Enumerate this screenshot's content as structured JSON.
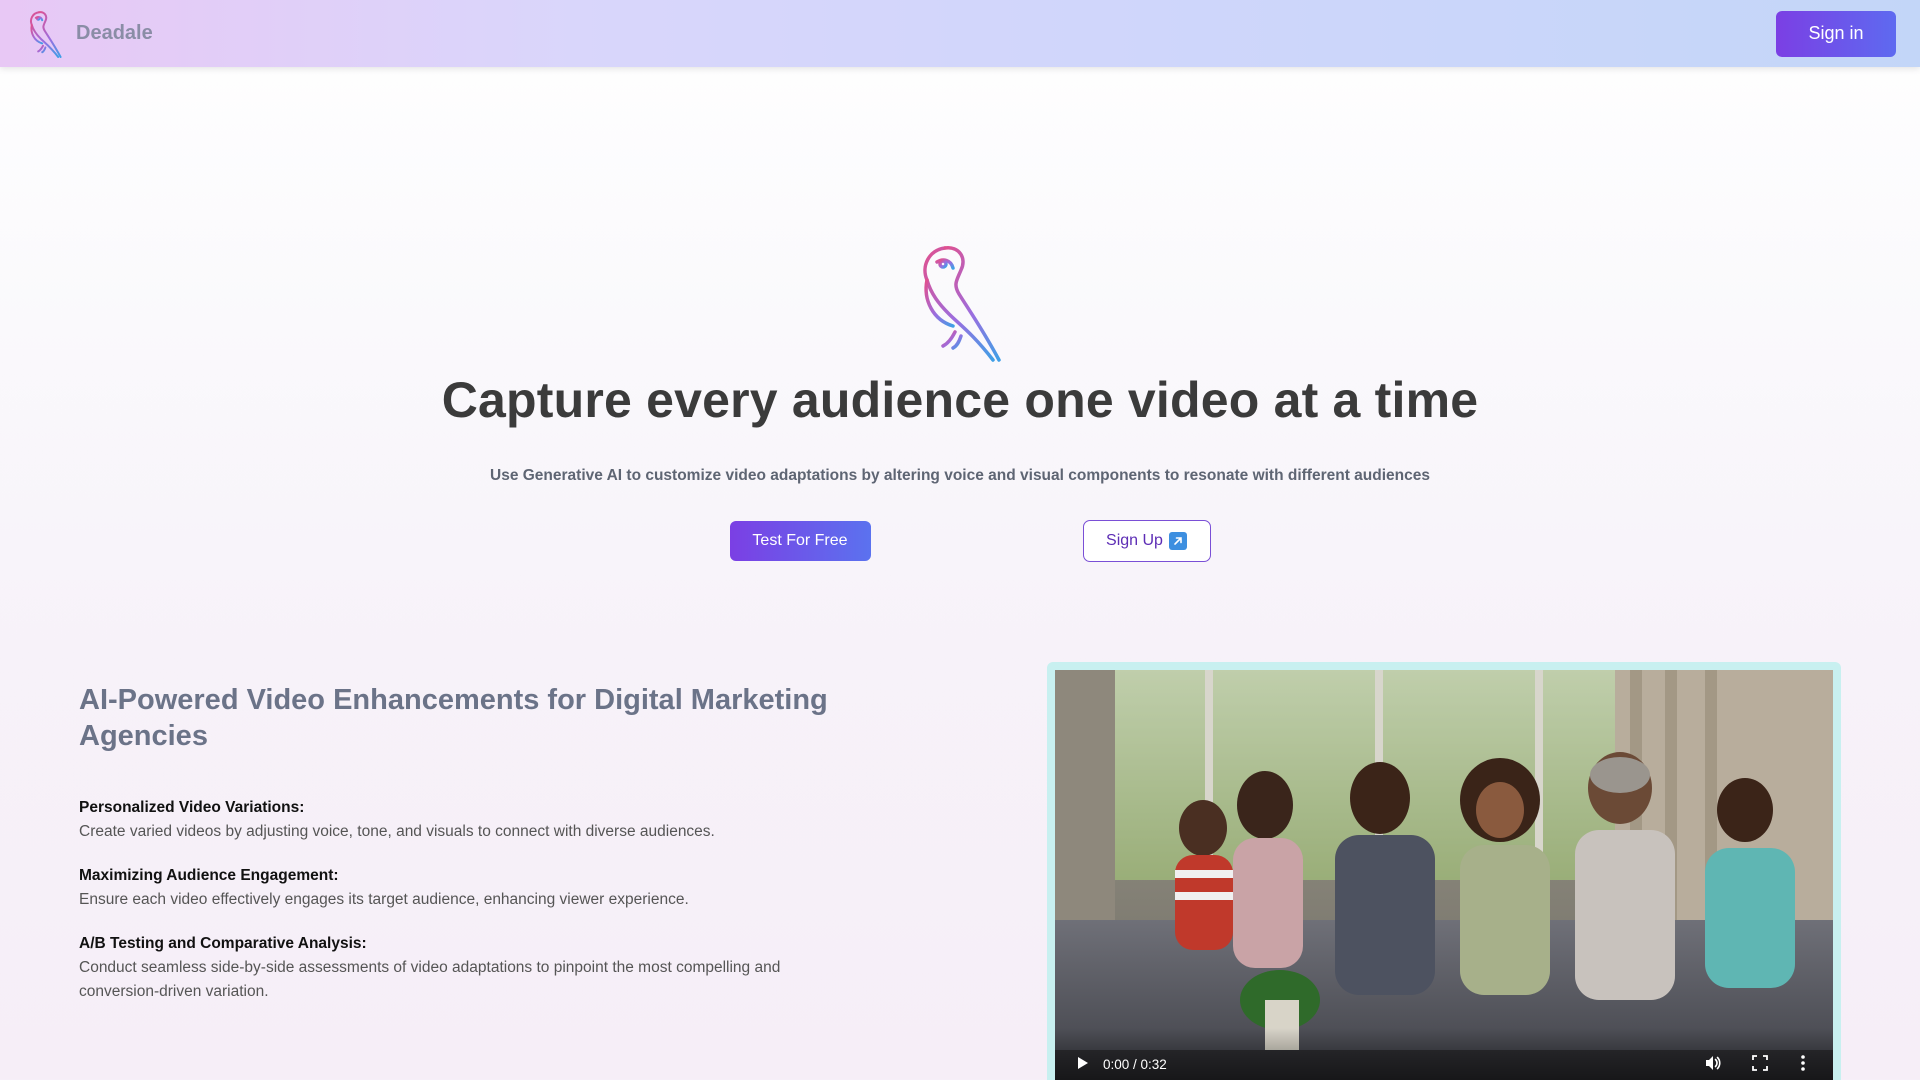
{
  "nav": {
    "brand_name": "Deadale",
    "signin_label": "Sign in",
    "logo_icon": "parrot-logo-icon"
  },
  "hero": {
    "title": "Capture every audience one video at a time",
    "subtitle": "Use Generative AI to customize video adaptations by altering voice and visual components to resonate with different audiences",
    "primary_cta": "Test For Free",
    "secondary_cta": "Sign Up",
    "secondary_cta_icon": "external-arrow-icon"
  },
  "features": {
    "heading": "AI-Powered Video Enhancements for Digital Marketing Agencies",
    "items": [
      {
        "title": "Personalized Video Variations:",
        "desc": "Create varied videos by adjusting voice, tone, and visuals to connect with diverse audiences."
      },
      {
        "title": "Maximizing Audience Engagement:",
        "desc": "Ensure each video effectively engages its target audience, enhancing viewer experience."
      },
      {
        "title": "A/B Testing and Comparative Analysis:",
        "desc": "Conduct seamless side-by-side assessments of video adaptations to pinpoint the most compelling and conversion-driven variation."
      }
    ]
  },
  "video": {
    "time": "0:00 / 0:32",
    "accent_border": "#c8f0f0"
  },
  "colors": {
    "primary": "#7b3fe4",
    "secondary": "#5b72ef",
    "heading": "#3b3b3b",
    "muted": "#6b7388"
  }
}
